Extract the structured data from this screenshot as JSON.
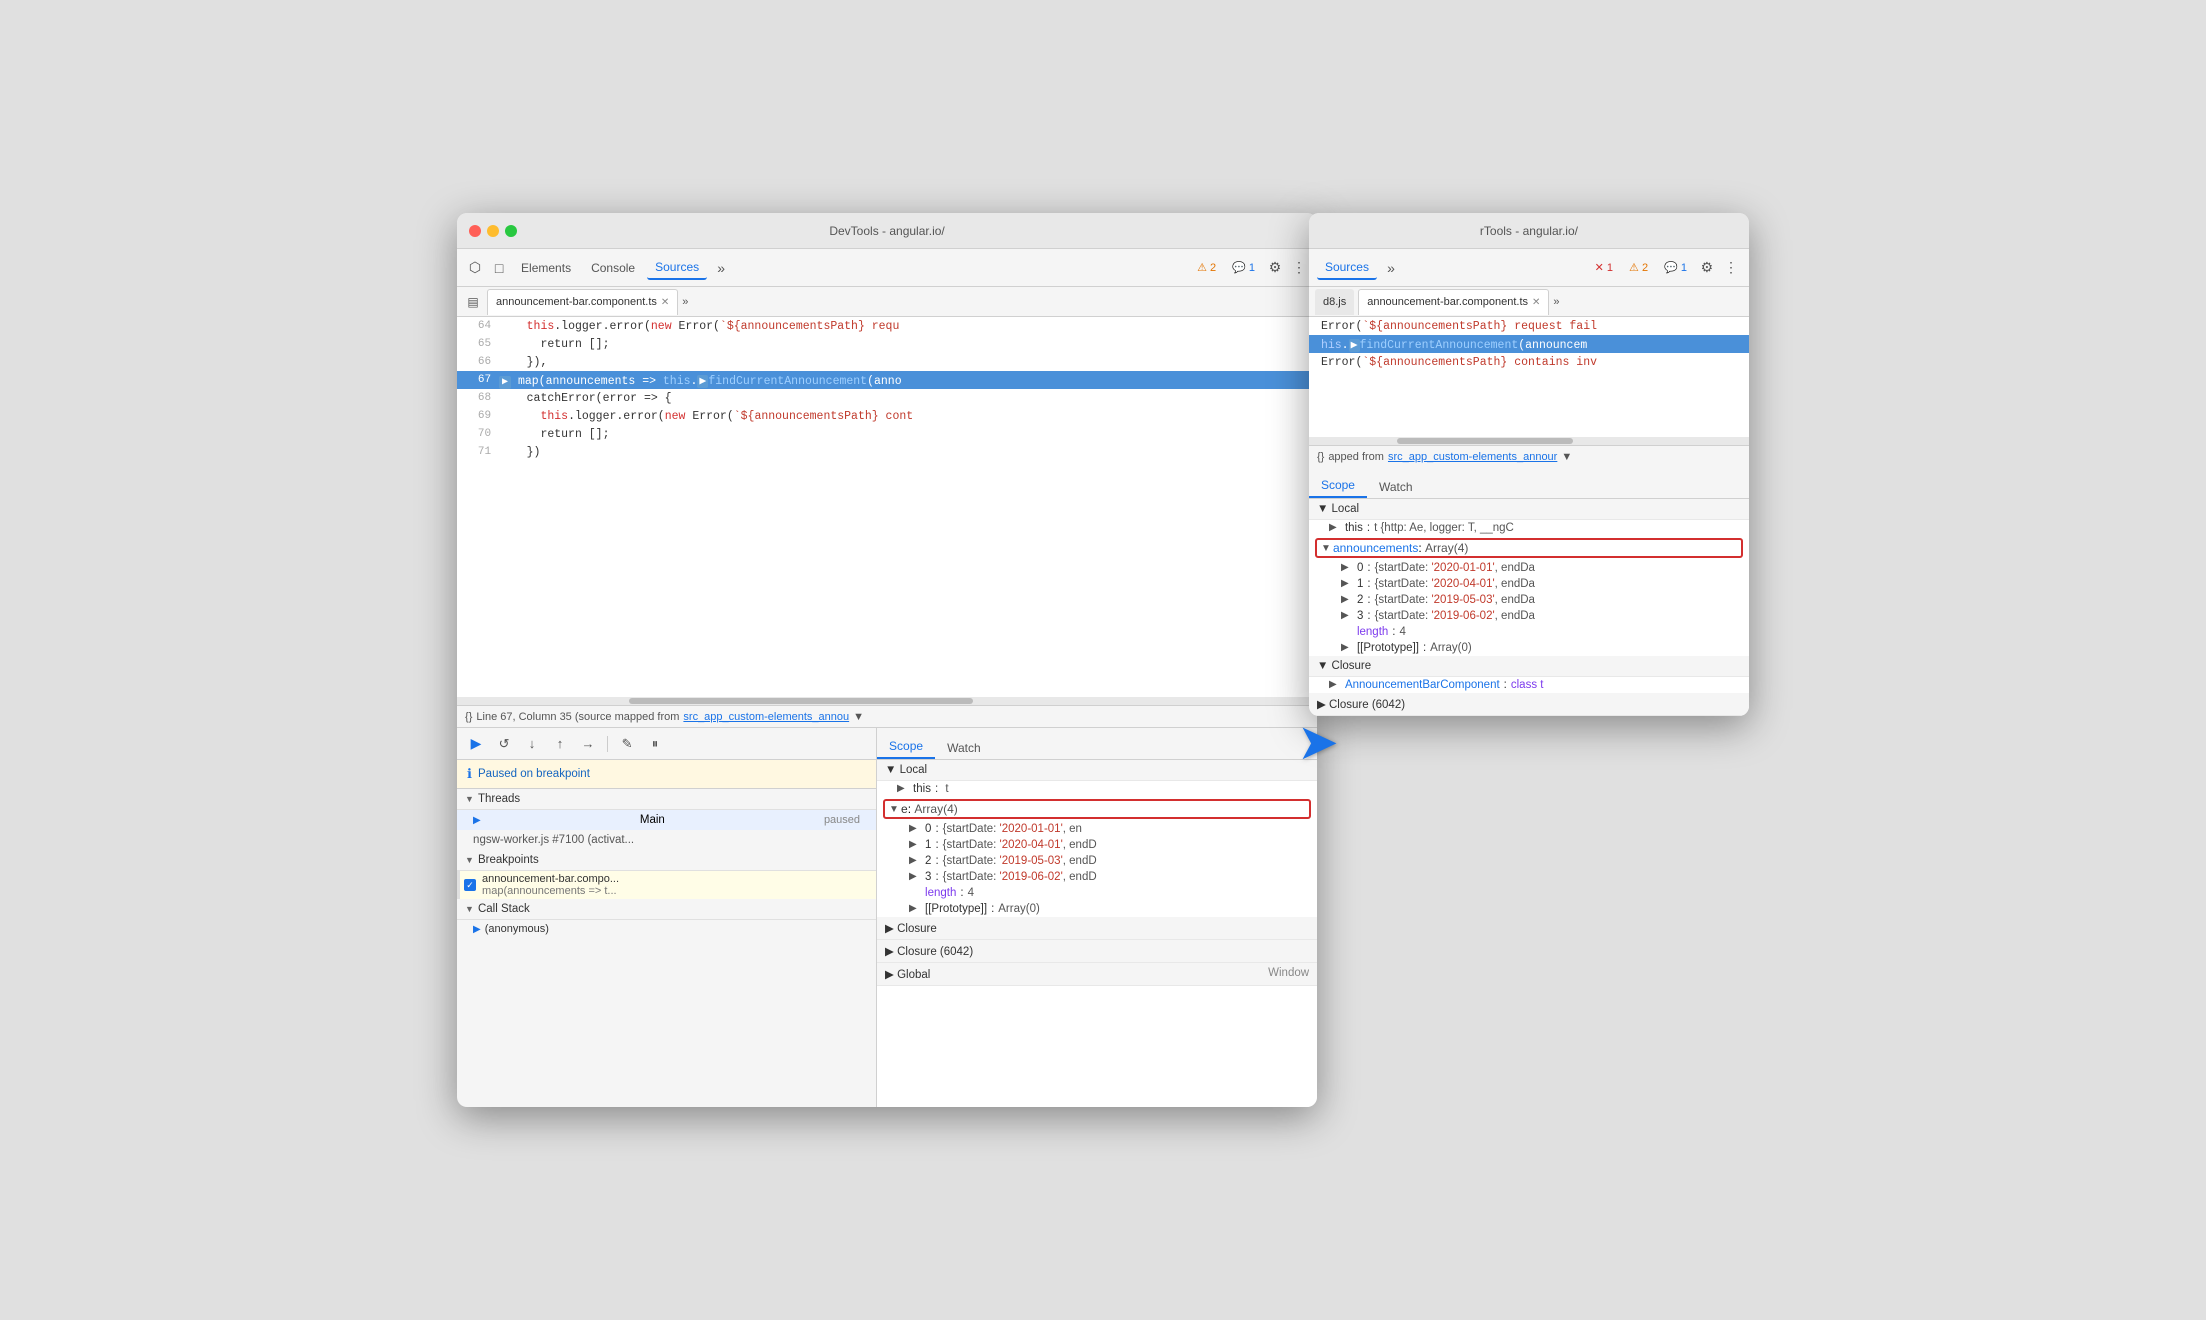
{
  "window1": {
    "title": "DevTools - angular.io/",
    "tabs": [
      "Elements",
      "Console",
      "Sources"
    ],
    "active_tab": "Sources",
    "file_tab": "announcement-bar.component.ts",
    "badges": {
      "warning": "⚠ 2",
      "message": "💬 1"
    },
    "code_lines": [
      {
        "num": "64",
        "content": "this.logger.error(new Error(`${announcementsPath} requ",
        "highlighted": false
      },
      {
        "num": "65",
        "content": "return [];",
        "highlighted": false
      },
      {
        "num": "66",
        "content": "}),",
        "highlighted": false
      },
      {
        "num": "67",
        "content": "map(announcements => this.findCurrentAnnouncement(anno",
        "highlighted": true
      },
      {
        "num": "68",
        "content": "catchError(error => {",
        "highlighted": false
      },
      {
        "num": "69",
        "content": "this.logger.error(new Error(`${announcementsPath} cont",
        "highlighted": false
      },
      {
        "num": "70",
        "content": "return [];",
        "highlighted": false
      },
      {
        "num": "71",
        "content": "})",
        "highlighted": false
      }
    ],
    "status_bar": {
      "icon": "{}",
      "text": "Line 67, Column 35 (source mapped from",
      "link": "src_app_custom-elements_annou"
    },
    "debug_toolbar": {
      "buttons": [
        "▶",
        "↺",
        "↓",
        "↑",
        "→",
        "✎",
        "⏸"
      ]
    },
    "paused": "Paused on breakpoint",
    "threads": {
      "label": "Threads",
      "items": [
        {
          "name": "Main",
          "status": "paused",
          "active": true
        },
        {
          "name": "ngsw-worker.js #7100 (activat...",
          "status": "",
          "active": false
        }
      ]
    },
    "breakpoints": {
      "label": "Breakpoints",
      "items": [
        {
          "file": "announcement-bar.compo...",
          "code": "map(announcements => t..."
        }
      ]
    },
    "callstack": {
      "label": "Call Stack",
      "items": [
        "(anonymous)"
      ]
    },
    "scope": {
      "tabs": [
        "Scope",
        "Watch"
      ],
      "active_tab": "Scope",
      "local": {
        "label": "Local",
        "items": [
          {
            "key": "this",
            "val": "t",
            "expand": false
          },
          {
            "key": "e",
            "val": "Array(4)",
            "highlighted": true,
            "expand": true
          },
          {
            "key": "0",
            "val": "{startDate: '2020-01-01', en",
            "indent": true,
            "expand": true
          },
          {
            "key": "1",
            "val": "{startDate: '2020-04-01', endD",
            "indent": true,
            "expand": true
          },
          {
            "key": "2",
            "val": "{startDate: '2019-05-03', endD",
            "indent": true,
            "expand": true
          },
          {
            "key": "3",
            "val": "{startDate: '2019-06-02', endD",
            "indent": true,
            "expand": true
          },
          {
            "key": "length",
            "val": "4",
            "indent": true
          },
          {
            "key": "[[Prototype]]",
            "val": "Array(0)",
            "indent": true,
            "expand": true
          }
        ]
      },
      "closure": {
        "items": [
          {
            "label": "Closure"
          },
          {
            "label": "Closure (6042)"
          },
          {
            "label": "Global",
            "val": "Window"
          }
        ]
      }
    }
  },
  "window2": {
    "title": "rTools - angular.io/",
    "active_tab": "Sources",
    "badges": {
      "error": "✕ 1",
      "warning": "⚠ 2",
      "message": "💬 1"
    },
    "file_tabs": [
      "d8.js",
      "announcement-bar.component.ts"
    ],
    "code_lines": [
      {
        "content": "Error(`${announcementsPath} request fail"
      },
      {
        "content": "his.findCurrentAnnouncement(announcem",
        "highlighted": true
      },
      {
        "content": "Error(`${announcementsPath} contains inv"
      }
    ],
    "status_bar": {
      "icon": "{}",
      "text": "apped from",
      "link": "src_app_custom-elements_annour"
    },
    "scope": {
      "tabs": [
        "Scope",
        "Watch"
      ],
      "active_tab": "Scope",
      "local": {
        "label": "Local",
        "items": [
          {
            "key": "this",
            "val": "t {http: Ae, logger: T, __ngC"
          },
          {
            "key": "announcements",
            "val": "Array(4)",
            "highlighted": true,
            "expand": true
          },
          {
            "key": "0",
            "val": "{startDate: '2020-01-01', endDa",
            "indent": true
          },
          {
            "key": "1",
            "val": "{startDate: '2020-04-01', endDa",
            "indent": true
          },
          {
            "key": "2",
            "val": "{startDate: '2019-05-03', endDa",
            "indent": true
          },
          {
            "key": "3",
            "val": "{startDate: '2019-06-02', endDa",
            "indent": true
          },
          {
            "key": "length",
            "val": "4",
            "indent": true
          },
          {
            "key": "[[Prototype]]",
            "val": "Array(0)",
            "indent": true
          }
        ]
      },
      "closure": {
        "items": [
          {
            "label": "Closure"
          },
          {
            "label": "AnnouncementBarComponent",
            "val": "class t",
            "isClass": true
          },
          {
            "label": "Closure (6042)"
          }
        ]
      }
    }
  },
  "arrow": {
    "symbol": "➜"
  }
}
